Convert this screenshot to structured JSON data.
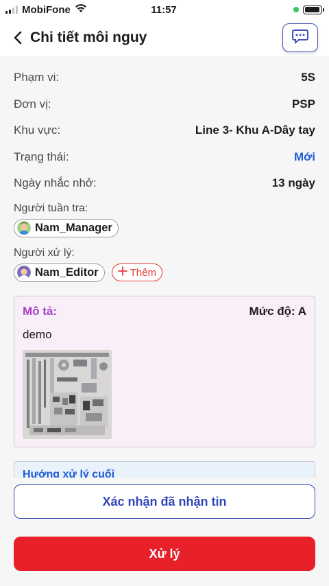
{
  "status_bar": {
    "carrier": "MobiFone",
    "time": "11:57",
    "wifi_icon": "wifi-icon",
    "battery_level": 0.95
  },
  "header": {
    "title": "Chi tiết môi nguy",
    "back_icon": "chevron-left-icon",
    "chat_icon": "chat-bubble-icon"
  },
  "details": {
    "scope_label": "Phạm vi:",
    "scope_value": "5S",
    "unit_label": "Đơn vị:",
    "unit_value": "PSP",
    "area_label": "Khu vực:",
    "area_value": "Line 3- Khu A-Dây tay",
    "status_label": "Trạng thái:",
    "status_value": "Mới",
    "reminder_label": "Ngày nhắc nhở:",
    "reminder_value": "13 ngày"
  },
  "patrol": {
    "label": "Người tuần tra:",
    "user": "Nam_Manager"
  },
  "handler": {
    "label": "Người xử lý:",
    "user": "Nam_Editor",
    "add_label": "Thêm"
  },
  "description": {
    "title": "Mô tả:",
    "level": "Mức độ: A",
    "text": "demo"
  },
  "guide": {
    "title": "Hướng xử lý cuối"
  },
  "actions": {
    "confirm_label": "Xác nhận đã nhận tin",
    "process_label": "Xử lý"
  },
  "colors": {
    "accent_blue": "#1e5bd6",
    "primary_red": "#e8202a",
    "purple_title": "#a43fc6",
    "desc_bg": "#f9eff8"
  }
}
